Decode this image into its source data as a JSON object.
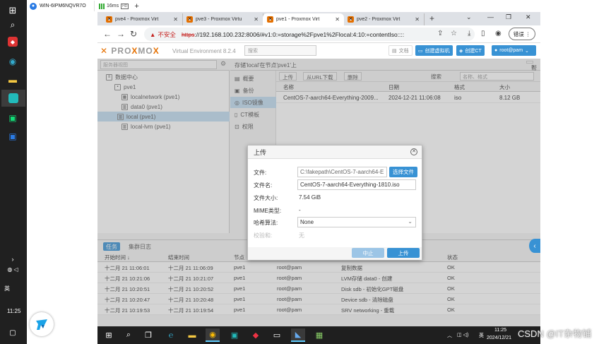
{
  "host": {
    "tab_title": "WIN-6IPM6NQVR7O",
    "ping": "16ms",
    "quality": "HD"
  },
  "dock": {
    "time": "11:25",
    "lang": "英"
  },
  "browser": {
    "tabs": [
      {
        "title": "pve4 - Proxmox Virt"
      },
      {
        "title": "pve3 - Proxmox Virtu"
      },
      {
        "title": "pve1 - Proxmox Virt"
      },
      {
        "title": "pve2 - Proxmox Virt"
      }
    ],
    "insecure_label": "不安全",
    "url_scheme": "https",
    "url_rest": "://192.168.100.232:8006/#v1:0:=storage%2Fpve1%2Flocal:4:10:=contentIso::::",
    "update_label": "错误"
  },
  "pve": {
    "version": "Virtual Environment 8.2.4",
    "search_placeholder": "搜索",
    "doc_label": "文档",
    "create_vm": "创建虚拟机",
    "create_ct": "创建CT",
    "user": "root@pam",
    "view_select": "服务器视图",
    "tree": {
      "datacenter": "数据中心",
      "node": "pve1",
      "items": [
        "localnetwork (pve1)",
        "data0 (pve1)",
        "local (pve1)",
        "local-lvm (pve1)"
      ]
    },
    "breadcrumb": "存储'local'在节点'pve1'上",
    "help": "帮助",
    "sidenav": [
      "概要",
      "备份",
      "ISO镜像",
      "CT模板",
      "权限"
    ],
    "grid_toolbar": {
      "upload": "上传",
      "from_url": "从URL下载",
      "delete": "删除",
      "search_label": "搜索",
      "search_placeholder": "名称、格式"
    },
    "grid_headers": {
      "name": "名称",
      "date": "日期",
      "format": "格式",
      "size": "大小"
    },
    "grid_rows": [
      {
        "name": "CentOS-7-aarch64-Everything-2009...",
        "date": "2024-12-21 11:06:08",
        "format": "iso",
        "size": "8.12 GB"
      }
    ]
  },
  "modal": {
    "title": "上传",
    "file_label": "文件:",
    "file_value": "C:\\fakepath\\CentOS-7-aarch64-E",
    "choose_button": "选择文件",
    "filename_label": "文件名:",
    "filename_value": "CentOS-7-aarch64-Everything-1810.iso",
    "filesize_label": "文件大小:",
    "filesize_value": "7.54 GiB",
    "mime_label": "MIME类型:",
    "mime_value": "-",
    "hash_label": "哈希算法:",
    "hash_value": "None",
    "checksum_label": "校验和:",
    "checksum_value": "无",
    "abort_button": "中止",
    "upload_button": "上传"
  },
  "tasks": {
    "tabs": [
      "任务",
      "集群日志"
    ],
    "headers": {
      "start": "开始时间 ↓",
      "end": "结束时间",
      "node": "节点",
      "user": "用户名",
      "desc": "说明",
      "status": "状态"
    },
    "rows": [
      {
        "start": "十二月 21 11:06:01",
        "end": "十二月 21 11:06:09",
        "node": "pve1",
        "user": "root@pam",
        "desc": "复制数据",
        "status": "OK"
      },
      {
        "start": "十二月 21 10:21:06",
        "end": "十二月 21 10:21:07",
        "node": "pve1",
        "user": "root@pam",
        "desc": "LVM存储 data0 - 创建",
        "status": "OK"
      },
      {
        "start": "十二月 21 10:20:51",
        "end": "十二月 21 10:20:52",
        "node": "pve1",
        "user": "root@pam",
        "desc": "Disk sdb - 初始化GPT磁盘",
        "status": "OK"
      },
      {
        "start": "十二月 21 10:20:47",
        "end": "十二月 21 10:20:48",
        "node": "pve1",
        "user": "root@pam",
        "desc": "Device sdb - 清除磁盘",
        "status": "OK"
      },
      {
        "start": "十二月 21 10:19:53",
        "end": "十二月 21 10:19:54",
        "node": "pve1",
        "user": "root@pam",
        "desc": "SRV networking - 重载",
        "status": "OK"
      }
    ]
  },
  "taskbar": {
    "time": "11:25",
    "date": "2024/12/21",
    "lang": "英"
  },
  "watermark": "CSDN @IT杂物铺"
}
